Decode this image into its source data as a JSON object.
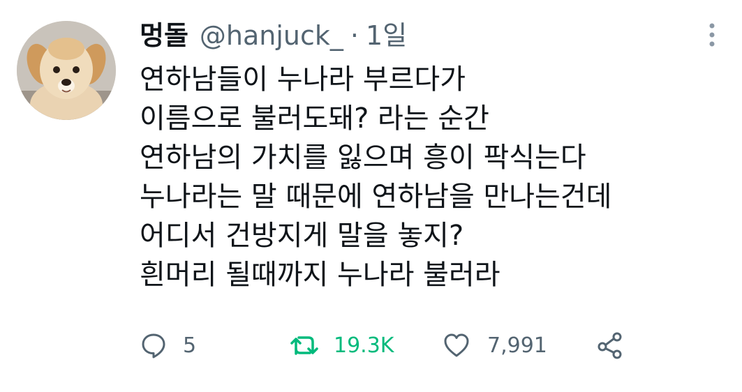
{
  "author": {
    "display_name": "멍돌",
    "handle": "@hanjuck_",
    "separator": "·",
    "time": "1일"
  },
  "tweet_lines": [
    "연하남들이 누나라 부르다가",
    "이름으로 불러도돼? 라는 순간",
    "연하남의 가치를 잃으며 흥이 팍식는다",
    "누나라는 말 때문에 연하남을 만나는건데",
    "어디서 건방지게 말을 놓지?",
    "흰머리 될때까지 누나라 불러라"
  ],
  "stats": {
    "replies": "5",
    "retweets": "19.3K",
    "likes": "7,991"
  },
  "icons": {
    "reply": "reply-icon",
    "retweet": "retweet-icon",
    "like": "heart-icon",
    "share": "share-icon",
    "more": "more-vertical-icon"
  },
  "colors": {
    "text": "#0f1419",
    "secondary": "#536471",
    "retweet_active": "#00ba7c"
  }
}
